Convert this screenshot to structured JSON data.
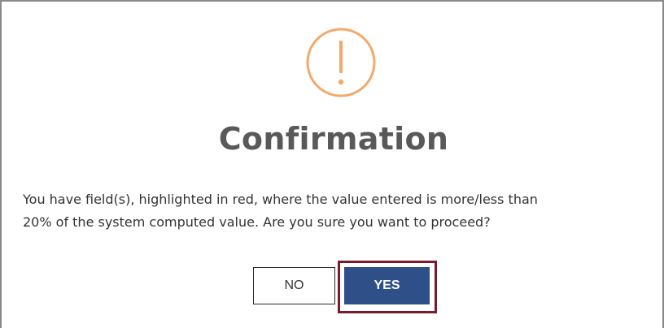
{
  "dialog": {
    "icon": "exclamation-circle-icon",
    "title": "Confirmation",
    "message_line1": "You have field(s), highlighted in red, where the value entered is more/less than",
    "message_line2": "20% of the system computed value. Are you sure you want to proceed?",
    "no_label": "NO",
    "yes_label": "YES"
  },
  "colors": {
    "icon_orange": "#f4a96b",
    "title_gray": "#595959",
    "yes_blue": "#2f4f89",
    "highlight_red": "#7a1b2b"
  }
}
